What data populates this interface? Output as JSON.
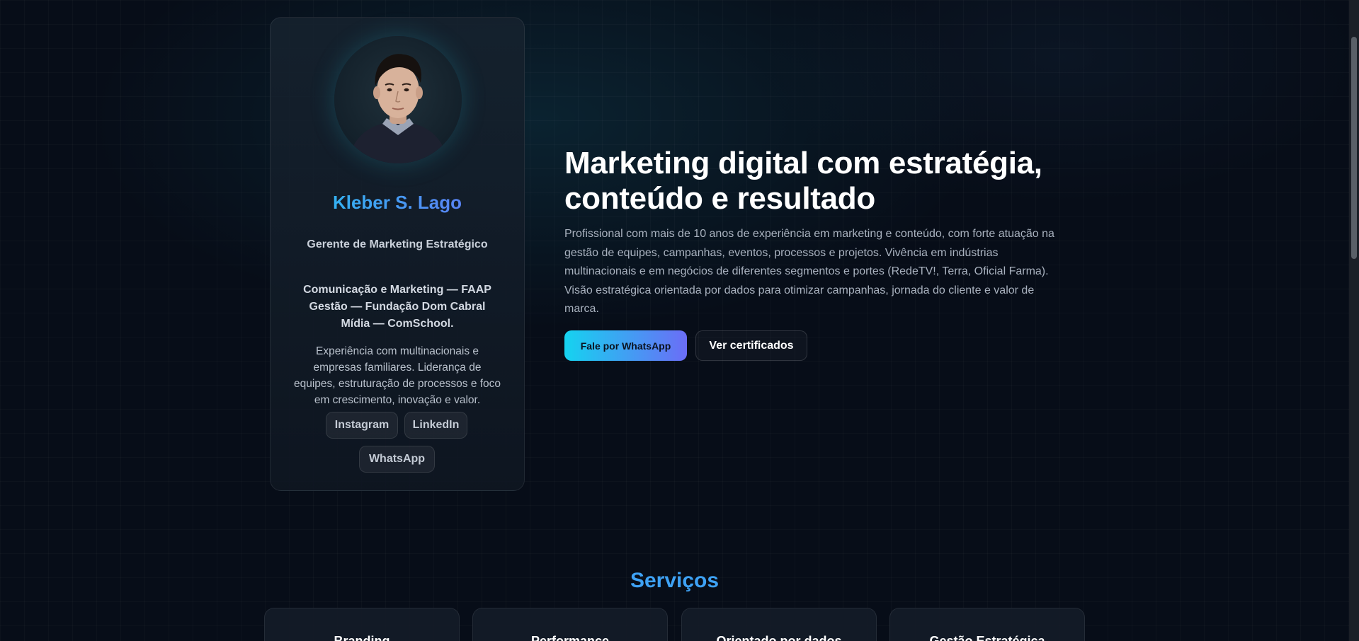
{
  "profile": {
    "name": "Kleber S. Lago",
    "role": "Gerente de Marketing Estratégico",
    "education": [
      "Comunicação e Marketing — FAAP",
      "Gestão — Fundação Dom Cabral",
      "Mídia — ComSchool."
    ],
    "bio": "Experiência com multinacionais e empresas familiares. Liderança de equipes, estruturação de processos e foco em crescimento, inovação e valor.",
    "links": {
      "instagram": "Instagram",
      "linkedin": "LinkedIn",
      "whatsapp": "WhatsApp"
    }
  },
  "hero": {
    "title_line1": "Marketing digital com estratégia,",
    "title_line2": "conteúdo e resultado",
    "description": "Profissional com mais de 10 anos de experiência em marketing e conteúdo, com forte atuação na gestão de equipes, campanhas, eventos, processos e projetos. Vivência em indústrias multinacionais e em negócios de diferentes segmentos e portes (RedeTV!, Terra, Oficial Farma). Visão estratégica orientada por dados para otimizar campanhas, jornada do cliente e valor de marca.",
    "primary_button": "Fale por WhatsApp",
    "secondary_button": "Ver certificados"
  },
  "services": {
    "title": "Serviços",
    "items": [
      "Branding",
      "Performance",
      "Orientado por dados",
      "Gestão Estratégica"
    ]
  },
  "colors": {
    "background": "#070d18",
    "accent_cyan": "#15d3f0",
    "accent_violet": "#6b6df6",
    "services_heading": "#3ea2f5"
  }
}
